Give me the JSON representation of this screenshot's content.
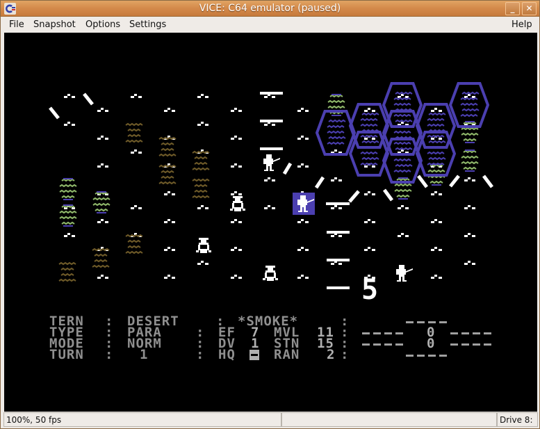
{
  "window": {
    "title": "VICE: C64 emulator (paused)",
    "minimize_label": "_",
    "close_label": "✕"
  },
  "menubar": {
    "items": [
      "File",
      "Snapshot",
      "Options",
      "Settings"
    ],
    "help": "Help"
  },
  "statusbar": {
    "speed": "100%, 50 fps",
    "middle": "",
    "drive": "Drive 8:"
  },
  "game": {
    "colors": {
      "background": "#000000",
      "desert": "#ffffff",
      "rough": "#6e5a28",
      "oasis_green": "#8fb86a",
      "oasis_blue": "#4b3fb0",
      "water": "#4b3fb0",
      "hud": "#8f8f8f",
      "selected_unit_bg": "#4b3fb0"
    },
    "terrain_legend": {
      "desert": "desert-dot",
      "rough": "rough-terrain",
      "oasis": "oasis",
      "water": "water-hex",
      "road": "road",
      "ridge": "ridge-bar"
    },
    "big_number": "5",
    "hud": {
      "rows": [
        {
          "label": "TERN",
          "value": "DESERT",
          "sep": ":",
          "right": "*SMOKE*"
        },
        {
          "label": "TYPE",
          "value": "PARA",
          "ef_label": "EF",
          "ef": "7",
          "mvl_label": "MVL",
          "mvl": "11"
        },
        {
          "label": "MODE",
          "value": "NORM",
          "dv_label": "DV",
          "dv": "1",
          "stn_label": "STN",
          "stn": "15"
        },
        {
          "label": "TURN",
          "value": "1",
          "hq_label": "HQ",
          "hq": "▬",
          "ran_label": "RAN",
          "ran": "2"
        }
      ],
      "score_left": "0",
      "score_right": "0"
    },
    "units": [
      {
        "kind": "rifleman",
        "col": 6,
        "row": 4,
        "selected": false
      },
      {
        "kind": "rifleman",
        "col": 7,
        "row": 7,
        "selected": true
      },
      {
        "kind": "rifleman",
        "col": 10,
        "row": 12,
        "selected": false
      },
      {
        "kind": "tank",
        "col": 5,
        "row": 7,
        "selected": false
      },
      {
        "kind": "tank",
        "col": 4,
        "row": 10,
        "selected": false
      },
      {
        "kind": "tank",
        "col": 6,
        "row": 12,
        "selected": false
      }
    ]
  }
}
